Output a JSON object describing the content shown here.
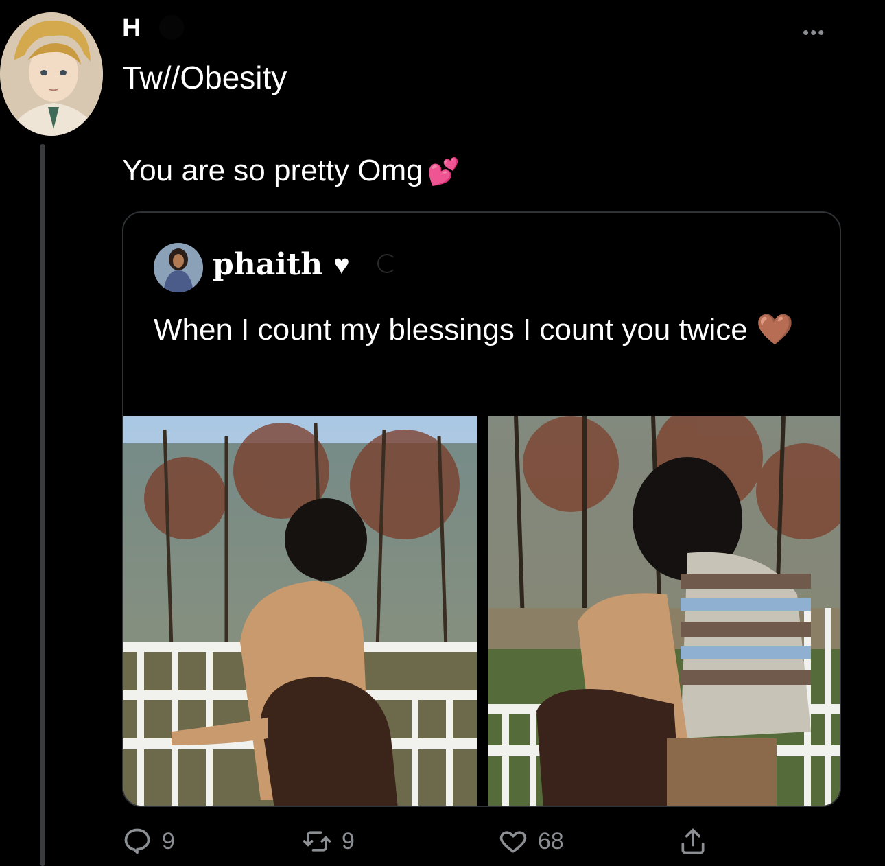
{
  "tweet": {
    "author_initial": "H",
    "content_warning": "Tw//Obesity",
    "text": "You are so pretty Omg",
    "emoji": "💕",
    "more_icon": "more-horizontal-icon"
  },
  "quote": {
    "author": "phaith",
    "author_heart": "♥",
    "text": "When I count my blessings I count you twice",
    "text_emoji": "🤎"
  },
  "actions": {
    "replies": "9",
    "retweets": "9",
    "likes": "68"
  },
  "colors": {
    "background": "#000000",
    "text": "#ffffff",
    "muted": "#8b8f94",
    "border": "#2f3336"
  }
}
